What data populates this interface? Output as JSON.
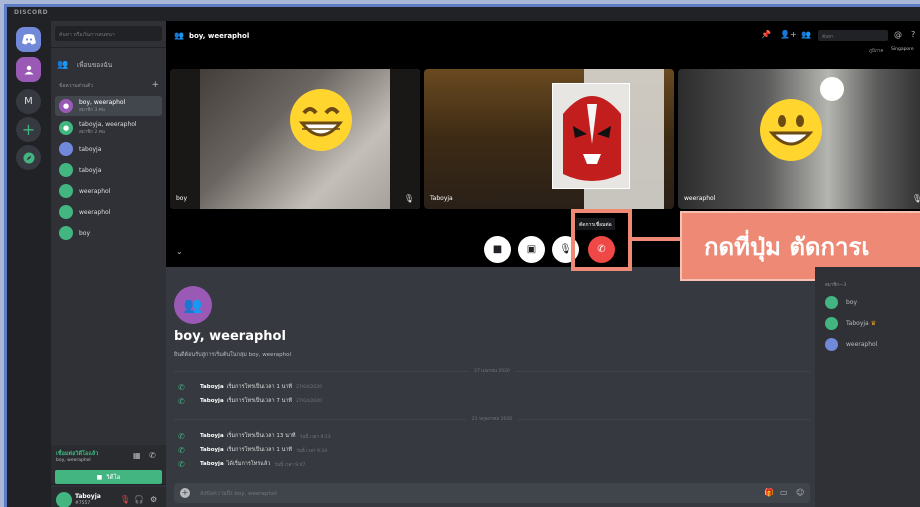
{
  "app": {
    "title": "DISCORD"
  },
  "servers": [
    {
      "name": "home",
      "icon": "discord-logo-icon"
    },
    {
      "name": "friends",
      "icon": "group-icon"
    },
    {
      "name": "M",
      "label": "M"
    },
    {
      "name": "add-server",
      "label": "+"
    },
    {
      "name": "explore",
      "icon": "compass-icon"
    }
  ],
  "sidebar": {
    "search_placeholder": "ค้นหา หรือเริ่มการสนทนา",
    "friends_label": "เพื่อนของฉัน",
    "dm_header": "ข้อความส่วนตัว",
    "dms": [
      {
        "name": "boy, weeraphol",
        "sub": "สมาชิก 3 คน",
        "color": "#9b59b6",
        "active": true
      },
      {
        "name": "taboyja, weeraphol",
        "sub": "สมาชิก 2 คน",
        "color": "#43b581"
      },
      {
        "name": "taboyja",
        "sub": "",
        "color": "#7289da"
      },
      {
        "name": "taboyja",
        "sub": "",
        "color": "#43b581"
      },
      {
        "name": "weeraphol",
        "sub": "",
        "color": "#43b581"
      },
      {
        "name": "weeraphol",
        "sub": "",
        "color": "#43b581"
      },
      {
        "name": "boy",
        "sub": "",
        "color": "#43b581"
      }
    ],
    "voice_status": "เชื่อมต่อวิดีโอแล้ว",
    "voice_sub": "boy, weeraphol",
    "video_button": "วิดีโอ",
    "user": {
      "name": "Taboyja",
      "tag": "#7557"
    }
  },
  "call": {
    "title": "boy, weeraphol",
    "search_placeholder": "ค้นหา",
    "region_label": "ภูมิภาค",
    "region_value": "Singapore",
    "participants": [
      {
        "name": "boy"
      },
      {
        "name": "Taboyja"
      },
      {
        "name": "weeraphol"
      }
    ],
    "tooltip": "ตัดการเชื่อมต่อ",
    "callout": "กดที่ปุ่ม ตัดการเ"
  },
  "chat": {
    "title": "boy, weeraphol",
    "subtitle": "ยินดีต้อนรับสู่การเริ่มต้นในกลุ่ม boy, weeraphol",
    "date1": "27 เมษายน 2020",
    "date2": "21 พฤษภาคม 2020",
    "messages": [
      {
        "author": "Taboyja",
        "text": "เริ่มการโทรเป็นเวลา 1 นาที",
        "time": "27/04/2020"
      },
      {
        "author": "Taboyja",
        "text": "เริ่มการโทรเป็นเวลา 7 นาที",
        "time": "27/04/2020"
      },
      {
        "author": "Taboyja",
        "text": "เริ่มการโทรเป็นเวลา 13 นาที",
        "time": "วันนี้ เวลา 9:13"
      },
      {
        "author": "Taboyja",
        "text": "เริ่มการโทรเป็นเวลา 1 นาที",
        "time": "วันนี้ เวลา 9:34"
      },
      {
        "author": "Taboyja",
        "text": "ได้เริ่มการโทรแล้ว",
        "time": "วันนี้ เวลา 9:47"
      }
    ],
    "composer_placeholder": "ส่งข้อความถึง boy, weeraphol"
  },
  "members": {
    "header": "สมาชิก—3",
    "list": [
      {
        "name": "boy",
        "color": "#43b581"
      },
      {
        "name": "Taboyja",
        "color": "#43b581",
        "owner": true
      },
      {
        "name": "weeraphol",
        "color": "#7289da"
      }
    ]
  },
  "colors": {
    "accent": "#7289da",
    "green": "#43b581",
    "red": "#f04747",
    "callout": "#ed8974"
  }
}
